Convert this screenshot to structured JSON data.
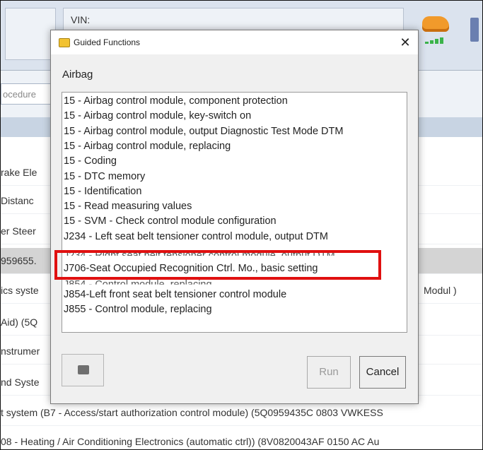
{
  "app": {
    "vin_label": "VIN:",
    "search_placeholder": "ocedure"
  },
  "background_rows": [
    {
      "text": "rake Ele",
      "right": ""
    },
    {
      "text": " Distanc",
      "right": ""
    },
    {
      "text": "er Steer",
      "right": ""
    },
    {
      "text": "959655.",
      "right": ""
    },
    {
      "text": "ics syste",
      "right": "Modul )"
    },
    {
      "text": "Aid) (5Q",
      "right": ""
    },
    {
      "text": "nstrumer",
      "right": ""
    },
    {
      "text": "nd Syste",
      "right": ""
    },
    {
      "text": "t system (B7 - Access/start authorization control module) (5Q0959435C   0803  VWKESS",
      "right": ""
    },
    {
      "text": "08 - Heating / Air Conditioning Electronics (automatic ctrl)) (8V0820043AF  0150  AC Au",
      "right": ""
    }
  ],
  "dialog": {
    "title": "Guided Functions",
    "close_glyph": "✕",
    "group": "Airbag",
    "items": [
      "15 - Airbag control module, component protection",
      "15 - Airbag control module, key-switch on",
      "15 - Airbag control module, output Diagnostic Test Mode DTM",
      "15 - Airbag control module, replacing",
      "15 - Coding",
      "15 - DTC memory",
      "15 - Identification",
      "15 - Read measuring values",
      "15 - SVM - Check control module configuration",
      "J234 - Left seat belt tensioner control module, output DTM",
      "J234 - Right seat belt tensioner control module, output DTM",
      "J706-Seat Occupied Recognition Ctrl. Mo., basic setting",
      "J854 - Control module, replacing",
      "J854-Left front seat belt tensioner control module",
      "J855 - Control module, replacing"
    ],
    "run_label": "Run",
    "cancel_label": "Cancel"
  },
  "icons": {
    "dialog_icon": "folder-icon",
    "tool_icon": "camera-icon",
    "car": "car-icon",
    "plug": "plug-icon"
  },
  "colors": {
    "highlight": "#e01010",
    "selected_row": "#d4d4d4"
  }
}
